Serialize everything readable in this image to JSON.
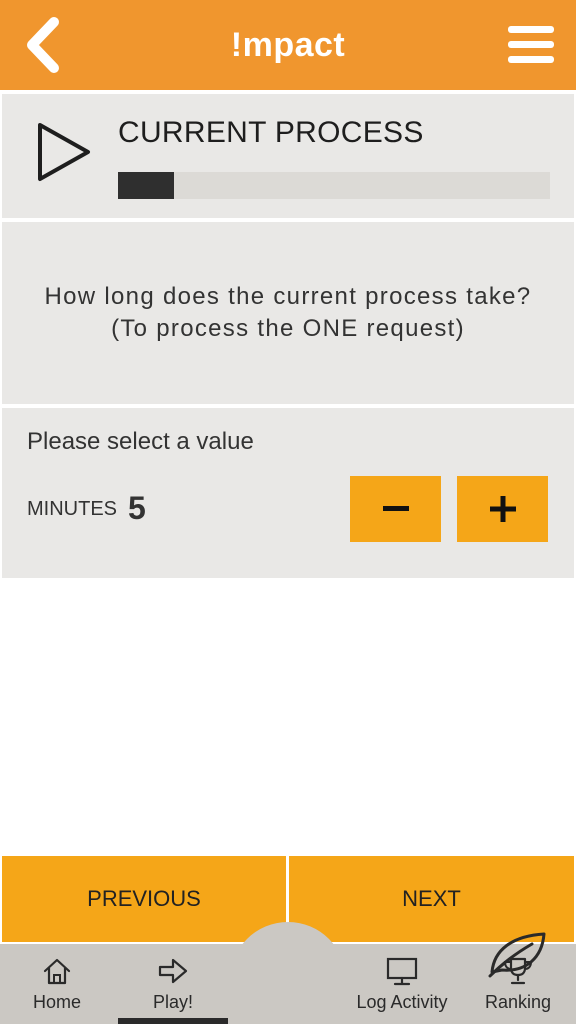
{
  "header": {
    "title": "!mpact"
  },
  "process": {
    "title": "CURRENT PROCESS",
    "progress_percent": 13
  },
  "question": {
    "line1": "How long does the current process take?",
    "line2": "(To process the ONE request)"
  },
  "selector": {
    "prompt": "Please select a value",
    "unit": "MINUTES",
    "value": "5",
    "minus_label": "−",
    "plus_label": "+"
  },
  "navigation": {
    "previous_label": "PREVIOUS",
    "next_label": "NEXT"
  },
  "tabbar": {
    "items": [
      {
        "label": "Home",
        "icon": "home-icon"
      },
      {
        "label": "Play!",
        "icon": "arrow-right-icon",
        "active": true
      },
      {
        "label": "",
        "icon": "leaf-icon"
      },
      {
        "label": "Log Activity",
        "icon": "monitor-icon"
      },
      {
        "label": "Ranking",
        "icon": "trophy-icon"
      }
    ]
  },
  "colors": {
    "header": "#f0962e",
    "accent_button": "#f5a618",
    "panel": "#e9e8e6",
    "tabbar": "#cbc8c3"
  }
}
